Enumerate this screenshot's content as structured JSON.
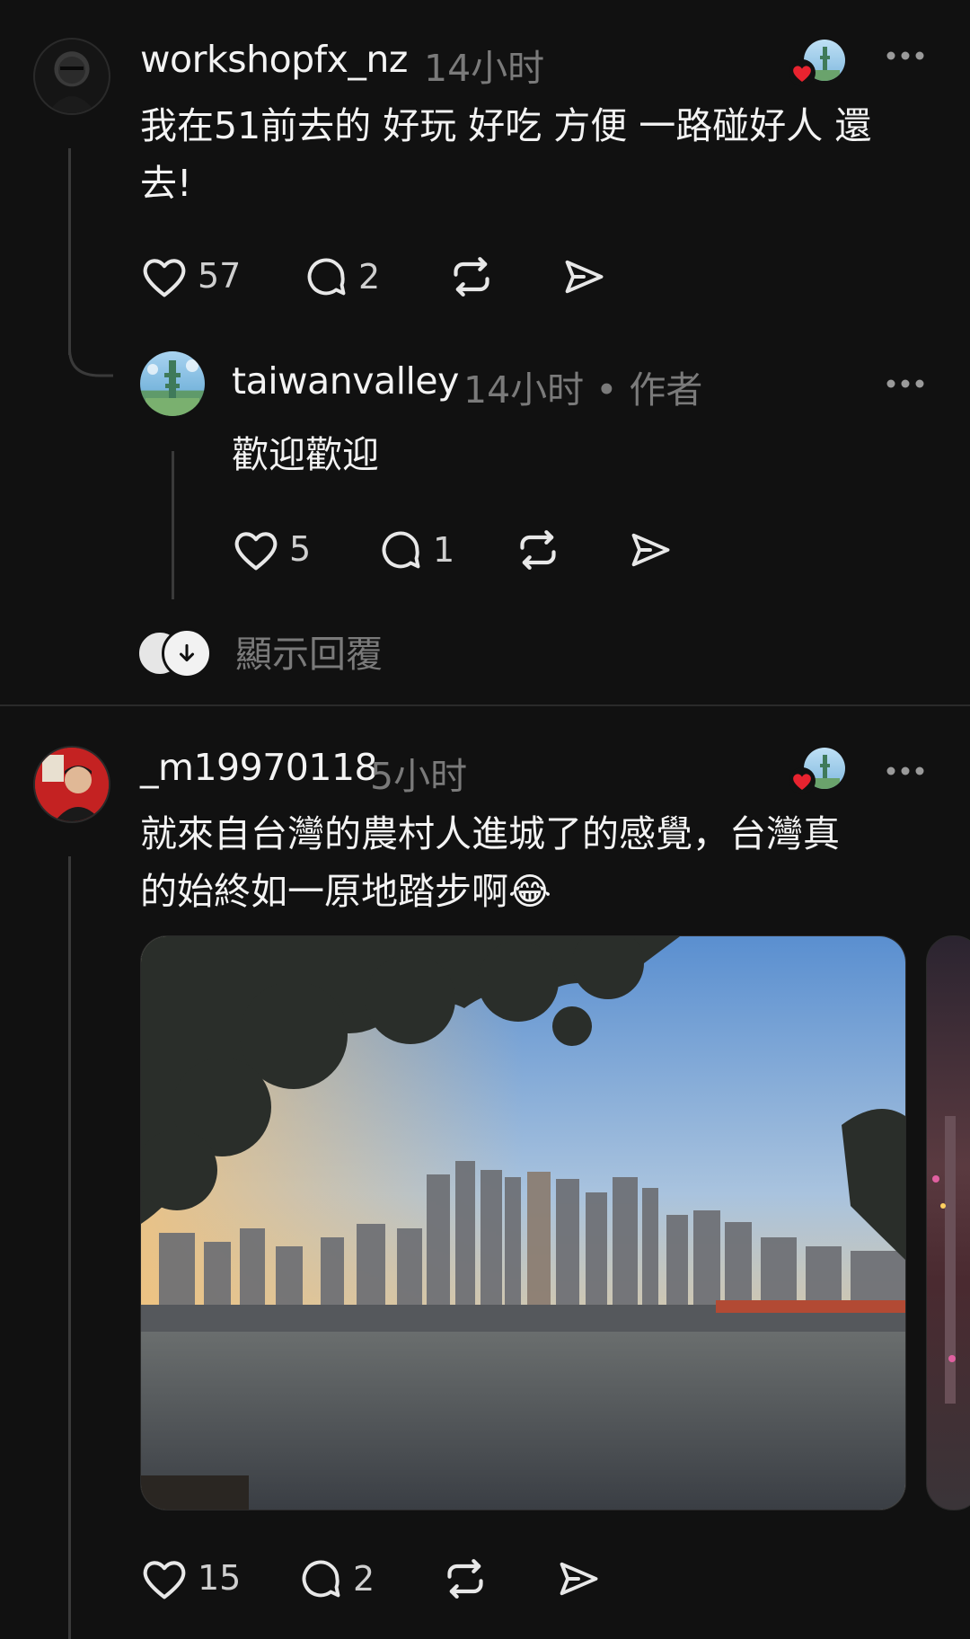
{
  "posts": [
    {
      "username": "workshopfx_nz",
      "time": "14小时",
      "text_line1": "我在51前去的 好玩 好吃 方便 一路碰好人 還",
      "text_line2": "去!",
      "likes": "57",
      "replies": "2"
    },
    {
      "username": "taiwanvalley",
      "time": "14小时 • 作者",
      "text": "歡迎歡迎",
      "likes": "5",
      "replies": "1"
    },
    {
      "username": "_m19970118",
      "time": "5小时",
      "text_line1": "就來自台灣的農村人進城了的感覺，台灣真",
      "text_line2": "的始終如一原地踏步啊😂",
      "likes": "15",
      "replies": "2"
    }
  ],
  "show_replies": "顯示回覆",
  "icons": {
    "like": "heart-icon",
    "reply": "comment-icon",
    "repost": "repost-icon",
    "share": "send-icon",
    "more": "more-icon"
  },
  "colors": {
    "background": "#111111",
    "text": "#f3f3f3",
    "muted": "#7a7a7a",
    "like_badge": "#e8232f"
  }
}
